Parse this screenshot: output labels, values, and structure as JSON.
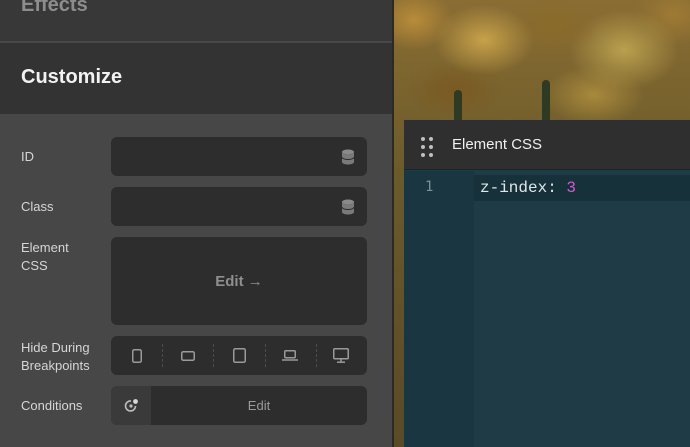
{
  "sidebar": {
    "effects_label": "Effects",
    "customize_label": "Customize",
    "fields": {
      "id_label": "ID",
      "class_label": "Class",
      "element_css_label": "Element\nCSS",
      "element_css_edit": "Edit →",
      "hide_breakpoints_label": "Hide During\nBreakpoints",
      "conditions_label": "Conditions",
      "conditions_edit": "Edit"
    },
    "breakpoints": [
      "mobile-portrait-icon",
      "mobile-landscape-icon",
      "tablet-portrait-icon",
      "laptop-icon",
      "desktop-icon"
    ]
  },
  "css_panel": {
    "title": "Element CSS",
    "line_number": "1",
    "code_property": "z-index: ",
    "code_value": "3"
  },
  "colors": {
    "sidebar_bg": "#474747",
    "panel_bg": "#1f3b45",
    "css_value": "#d15bd0"
  }
}
